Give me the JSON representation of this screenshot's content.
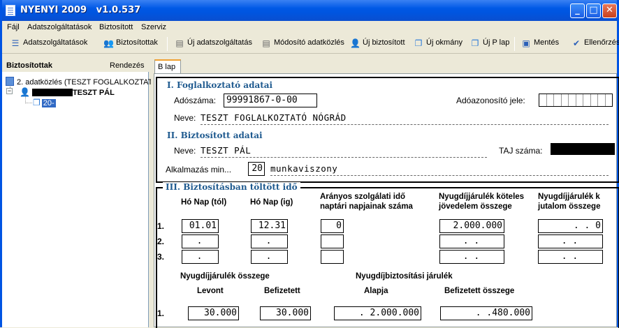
{
  "window": {
    "title": "NYENYI 2009   v1.0.537",
    "min": "_",
    "max": "□",
    "close": "✕"
  },
  "menu": [
    "Fájl",
    "Adatszolgáltatások",
    "Biztosított",
    "Szerviz"
  ],
  "toolbar": [
    {
      "label": "Adatszolgáltatások",
      "icon": "list-icon"
    },
    {
      "label": "Biztosítottak",
      "icon": "users-icon"
    },
    {
      "label": "Új adatszolgáltatás",
      "icon": "new-doc-icon"
    },
    {
      "label": "Módosító adatközlés",
      "icon": "edit-doc-icon"
    },
    {
      "label": "Új biztosított",
      "icon": "new-user-icon"
    },
    {
      "label": "Új okmány",
      "icon": "new-page-icon"
    },
    {
      "label": "Új P lap",
      "icon": "new-page-icon"
    },
    {
      "label": "Mentés",
      "icon": "save-icon"
    },
    {
      "label": "Ellenőrzés",
      "icon": "check-icon"
    }
  ],
  "left": {
    "title": "Biztosítottak",
    "sort": "Rendezés",
    "tree": {
      "root": "2. adatközlés (TESZT FOGLALKOZTATÓ",
      "person": "TESZT PÁL",
      "child": "20-"
    }
  },
  "tab": "B lap",
  "section1": {
    "title": "I. Foglalkoztató adatai",
    "adoszam_label": "Adószáma:",
    "adoszam": "99991867-0-00",
    "adoazon_label": "Adóazonosító jele:",
    "neve_label": "Neve:",
    "neve": "TESZT FOGLALKOZTATÓ NÓGRÁD"
  },
  "section2": {
    "title": "II. Biztosított adatai",
    "neve_label": "Neve:",
    "neve": "TESZT PÁL",
    "taj_label": "TAJ száma:",
    "alk_label": "Alkalmazás min...",
    "alk_code": "20",
    "alk_text": "munkaviszony"
  },
  "section3": {
    "title": "III. Biztosításban töltött idő",
    "headers": {
      "from": "Hó Nap (tól)",
      "to": "Hó Nap (ig)",
      "aranyos": "Arányos szolgálati idő",
      "aranyos2": "naptári napjainak száma",
      "kotel": "Nyugdíjjárulék köteles",
      "kotel2": "jövedelem összege",
      "jutalom": "Nyugdíjjárulék k",
      "jutalom2": "jutalom összege"
    },
    "rows": [
      {
        "num": "1.",
        "from": "01.01",
        "to": "12.31",
        "days": "0",
        "income": "2.000.000",
        "jutalom": ".   .   0"
      },
      {
        "num": "2.",
        "from": ".",
        "to": ".",
        "days": "",
        "income": ".       .",
        "jutalom": ".   ."
      },
      {
        "num": "3.",
        "from": ".",
        "to": ".",
        "days": "",
        "income": ".       .",
        "jutalom": ".   ."
      }
    ],
    "contrib": {
      "title": "Nyugdíjjárulék összege",
      "levont": "Levont",
      "befizetett": "Befizetett",
      "title2": "Nyugdíjbiztosítási járulék",
      "alapja": "Alapja",
      "befizetett2": "Befizetett összege",
      "row": {
        "num": "1.",
        "levont": "30.000",
        "befizetett": "30.000",
        "alapja": ".   2.000.000",
        "bef2": ".    .480.000"
      }
    }
  }
}
